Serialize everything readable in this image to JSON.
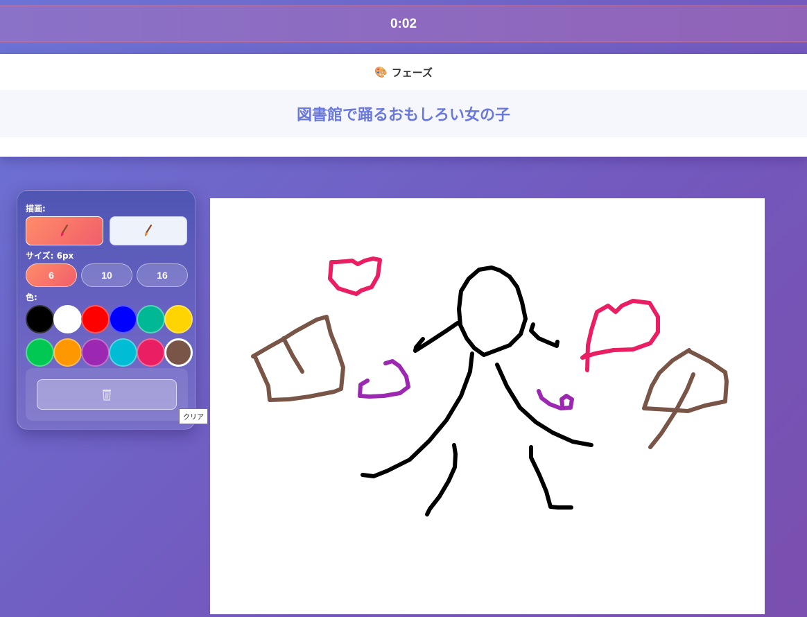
{
  "timer": {
    "text": "0:02"
  },
  "phase": {
    "label": "フェーズ",
    "icon": "palette-icon"
  },
  "prompt": {
    "text": "図書館で踊るおもしろい女の子"
  },
  "tools": {
    "draw_label": "描画:",
    "pen": {
      "icon": "brush-icon",
      "active": true
    },
    "eraser": {
      "icon": "eraser-brush-icon",
      "active": false
    },
    "size_label": "サイズ: 6px",
    "sizes": [
      {
        "label": "6",
        "active": true
      },
      {
        "label": "10",
        "active": false
      },
      {
        "label": "16",
        "active": false
      }
    ],
    "color_label": "色:",
    "colors": [
      "#000000",
      "#ffffff",
      "#ff0000",
      "#0000ff",
      "#00b894",
      "#ffd400",
      "#00c853",
      "#ff9800",
      "#9c27b0",
      "#00bcd4",
      "#e91e63",
      "#795548"
    ],
    "selected_color": "#795548",
    "clear": {
      "icon": "wastebasket-icon",
      "tooltip": "クリア"
    }
  },
  "accent_colors": {
    "prompt": "#6a78dc",
    "active_button": "#f05e6a"
  }
}
